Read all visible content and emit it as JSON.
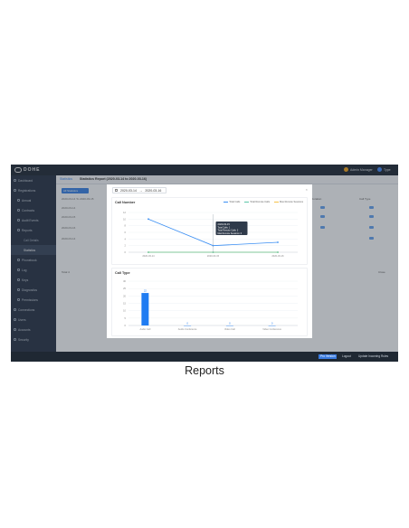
{
  "app": {
    "logo_text": "DOHE",
    "user_label": "Admin Manager",
    "lang_label": "Type"
  },
  "sidebar": {
    "items": [
      {
        "label": "Dashboard",
        "level": 0
      },
      {
        "label": "Registrations",
        "level": 0
      },
      {
        "label": "Annual",
        "level": 1
      },
      {
        "label": "Contracts",
        "level": 1
      },
      {
        "label": "Audit Events",
        "level": 1
      },
      {
        "label": "Reports",
        "level": 1
      },
      {
        "label": "Call Details",
        "level": 2
      },
      {
        "label": "Statistics",
        "level": 2,
        "active": true
      },
      {
        "label": "Phonebook",
        "level": 1
      },
      {
        "label": "Log",
        "level": 1
      },
      {
        "label": "Keys",
        "level": 1
      },
      {
        "label": "Diagnostics",
        "level": 1
      },
      {
        "label": "Permissions",
        "level": 1
      },
      {
        "label": "Connections",
        "level": 0
      },
      {
        "label": "Users",
        "level": 0
      },
      {
        "label": "Accounts",
        "level": 0
      },
      {
        "label": "Security",
        "level": 0
      }
    ]
  },
  "header": {
    "back": "Statistics",
    "title": "Statistics Report (2020-03-14 to 2020-03-16)"
  },
  "background": {
    "button": "All Statistics",
    "rows": [
      "2020-03-14 To 2020-03-15",
      "2020-03-14",
      "2020-03-15",
      "2020-03-16",
      "2020-03-14"
    ],
    "columns": [
      "Calls",
      "Duration",
      "Call Type"
    ],
    "footer_left": "Total 4",
    "footer_right": "Close"
  },
  "statusbar": {
    "primary": "Pro Version",
    "btn2": "Logout",
    "btn3": "Update Incoming Rules"
  },
  "modal": {
    "date_start": "2020-03-14",
    "date_end": "2020-03-16",
    "close": "×",
    "card1_title": "Call Number",
    "card2_title": "Call Type",
    "tooltip": {
      "date": "2020-03-15",
      "lines": [
        "Total Calls: 1",
        "Total Remote Calls: 3",
        "Max Remote Sessions: 0"
      ]
    }
  },
  "caption": "Reports",
  "chart_data": [
    {
      "type": "line",
      "title": "Call Number",
      "x": [
        "2020-03-14",
        "2020-03-15",
        "2020-03-16"
      ],
      "ylim": [
        0,
        12
      ],
      "y_ticks": [
        0,
        2,
        4,
        6,
        8,
        10,
        12
      ],
      "grid": true,
      "legend_position": "top-right",
      "series": [
        {
          "name": "Total Calls",
          "values": [
            10,
            2,
            3
          ],
          "color": "#3b8ff3"
        },
        {
          "name": "Total Remote Calls",
          "values": [
            0,
            0,
            0
          ],
          "color": "#5cc6a8"
        },
        {
          "name": "Max Remote Sessions",
          "values": [
            0,
            0,
            0
          ],
          "color": "#f5c24a"
        }
      ]
    },
    {
      "type": "bar",
      "title": "Call Type",
      "categories": [
        "Audio Call",
        "Audio Conference",
        "Video Call",
        "Video Conference"
      ],
      "values": [
        22,
        0,
        0,
        0
      ],
      "ylim": [
        0,
        30
      ],
      "y_ticks": [
        0,
        5,
        10,
        15,
        20,
        25,
        30
      ],
      "color": "#1f7cf2",
      "data_labels": true
    }
  ]
}
